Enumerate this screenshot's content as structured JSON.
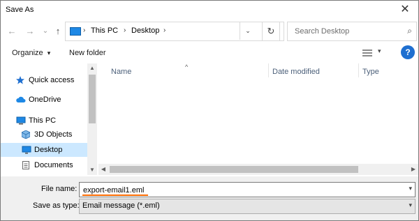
{
  "window": {
    "title": "Save As",
    "close": "✕"
  },
  "nav": {
    "back": "←",
    "forward": "→",
    "recent": "⌄",
    "up": "↑",
    "refresh": "↻"
  },
  "address": {
    "crumbs": [
      "This PC",
      "Desktop"
    ],
    "sep": "›",
    "dropdown": "⌄"
  },
  "search": {
    "placeholder": "Search Desktop",
    "icon": "⌕"
  },
  "toolbar": {
    "organize": "Organize",
    "organize_caret": "▾",
    "new_folder": "New folder",
    "view_caret": "▾",
    "help": "?"
  },
  "sidebar": {
    "items": [
      {
        "label": "Quick access",
        "icon": "star-icon"
      },
      {
        "label": "OneDrive",
        "icon": "cloud-icon"
      },
      {
        "label": "This PC",
        "icon": "pc-icon"
      },
      {
        "label": "3D Objects",
        "icon": "cube-icon"
      },
      {
        "label": "Desktop",
        "icon": "desktop-icon",
        "selected": true
      },
      {
        "label": "Documents",
        "icon": "document-icon"
      }
    ]
  },
  "filelist": {
    "columns": [
      "Name",
      "Date modified",
      "Type"
    ],
    "sort_caret": "^"
  },
  "scroll": {
    "up": "▲",
    "down": "▼",
    "left": "◀",
    "right": "▶"
  },
  "form": {
    "file_name_label": "File name:",
    "file_name_value": "export-email1.eml",
    "save_type_label": "Save as type:",
    "save_type_value": "Email message (*.eml)",
    "dropdown": "▾"
  },
  "colors": {
    "accent": "#1e6fd0",
    "selected": "#cce8ff",
    "underline": "#ff6a00"
  }
}
